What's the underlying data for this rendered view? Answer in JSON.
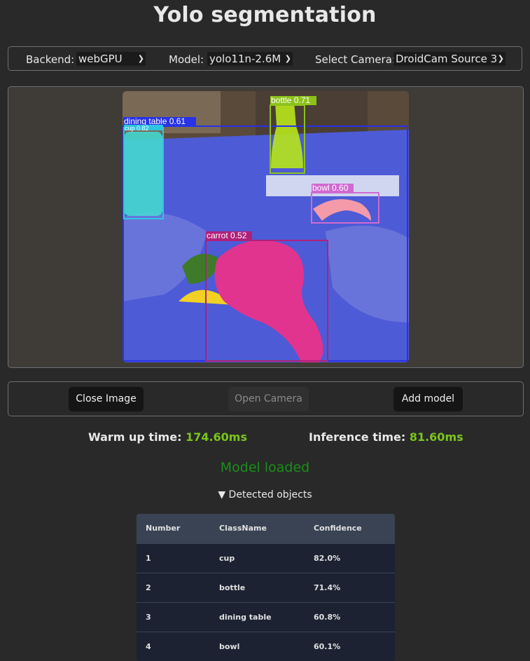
{
  "title": "Yolo segmentation",
  "settings": {
    "backend_label": "Backend:",
    "backend_value": "webGPU",
    "model_label": "Model:",
    "model_value": "yolo11n-2.6M",
    "camera_label": "Select Camera:",
    "camera_value": "DroidCam Source 3"
  },
  "detections": {
    "cup": "cup 0.82",
    "bottle": "bottle 0.71",
    "dining_table": "dining table 0.61",
    "bowl": "bowl 0.60",
    "carrot": "carrot 0.52"
  },
  "buttons": {
    "close_image": "Close Image",
    "open_camera": "Open Camera",
    "add_model": "Add model"
  },
  "stats": {
    "warmup_label": "Warm up time:",
    "warmup_value": "174.60ms",
    "inference_label": "Inference time:",
    "inference_value": "81.60ms"
  },
  "status": "Model loaded",
  "details_summary": "▼ Detected objects",
  "table": {
    "headers": [
      "Number",
      "ClassName",
      "Confidence"
    ],
    "rows": [
      [
        "1",
        "cup",
        "82.0%"
      ],
      [
        "2",
        "bottle",
        "71.4%"
      ],
      [
        "3",
        "dining table",
        "60.8%"
      ],
      [
        "4",
        "bowl",
        "60.1%"
      ]
    ]
  },
  "colors": {
    "accent_green": "#7ac51d",
    "status_green": "#1a8f1a",
    "table_mask": "#4d5bd6",
    "carrot_mask": "#e0348f",
    "bottle_mask": "#b7e61a",
    "cup_mask": "#45d8d0",
    "bowl_box": "#d06ad0"
  }
}
